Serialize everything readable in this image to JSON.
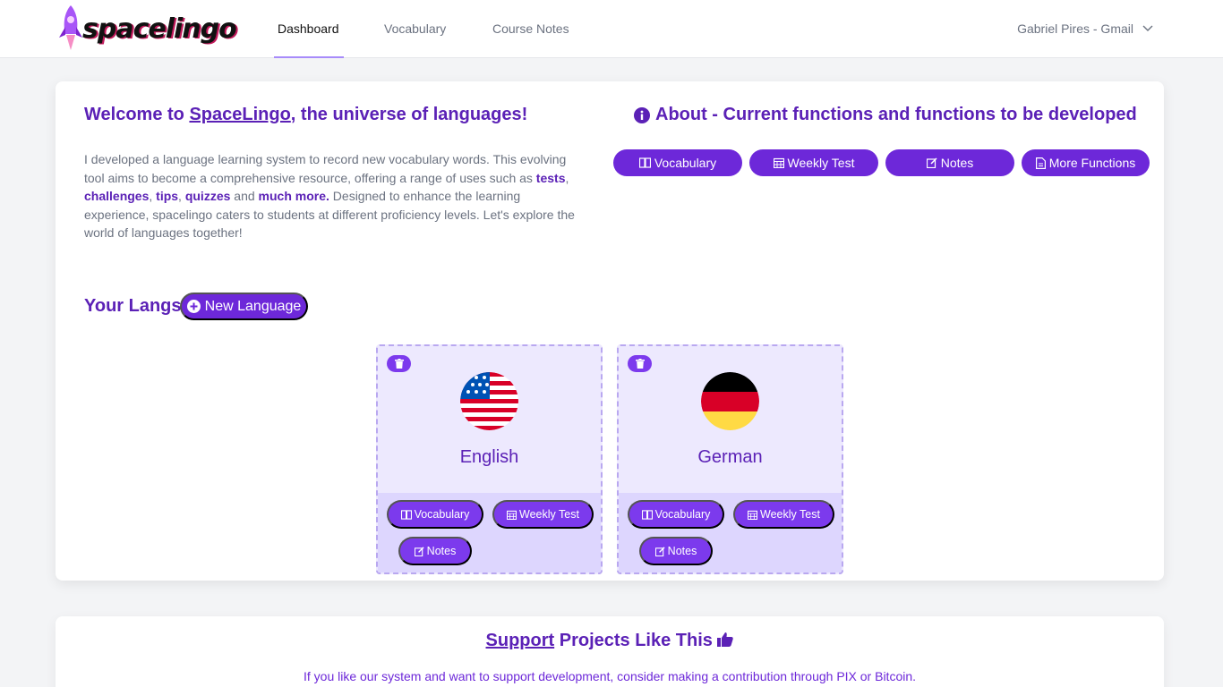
{
  "brand": {
    "name": "spacelingo"
  },
  "nav": {
    "items": [
      {
        "label": "Dashboard",
        "active": true
      },
      {
        "label": "Vocabulary",
        "active": false
      },
      {
        "label": "Course Notes",
        "active": false
      }
    ],
    "user": "Gabriel Pires - Gmail"
  },
  "welcome": {
    "prefix": "Welcome to ",
    "link": "SpaceLingo",
    "suffix": ", the universe of languages!"
  },
  "intro": {
    "p1": "I developed a language learning system to record new vocabulary words. This evolving tool aims to become a comprehensive resource, offering a range of uses such as ",
    "tests": "tests",
    "comma1": ", ",
    "challenges": "challenges",
    "comma2": ", ",
    "tips": "tips",
    "comma3": ", ",
    "quizzes": "quizzes",
    "and": " and ",
    "more": "much more.",
    "p2": " Designed to enhance the learning experience, spacelingo caters to students at different proficiency levels. Let's explore the world of languages together!"
  },
  "about": {
    "title": "About - Current functions and functions to be developed",
    "buttons": [
      "Vocabulary",
      "Weekly Test",
      "Notes",
      "More Functions"
    ]
  },
  "langs": {
    "title": "Your Langs",
    "new_button": "New Language",
    "cards": [
      {
        "name": "English",
        "buttons": [
          "Vocabulary",
          "Weekly Test",
          "Notes"
        ]
      },
      {
        "name": "German",
        "buttons": [
          "Vocabulary",
          "Weekly Test",
          "Notes"
        ]
      }
    ]
  },
  "support": {
    "link": "Support",
    "rest": " Projects Like This",
    "text": "If you like our system and want to support development, consider making a contribution through PIX or Bitcoin."
  },
  "colors": {
    "accent": "#6d28d9",
    "accent_light": "#ede9fe",
    "heading": "#5b21b6"
  }
}
